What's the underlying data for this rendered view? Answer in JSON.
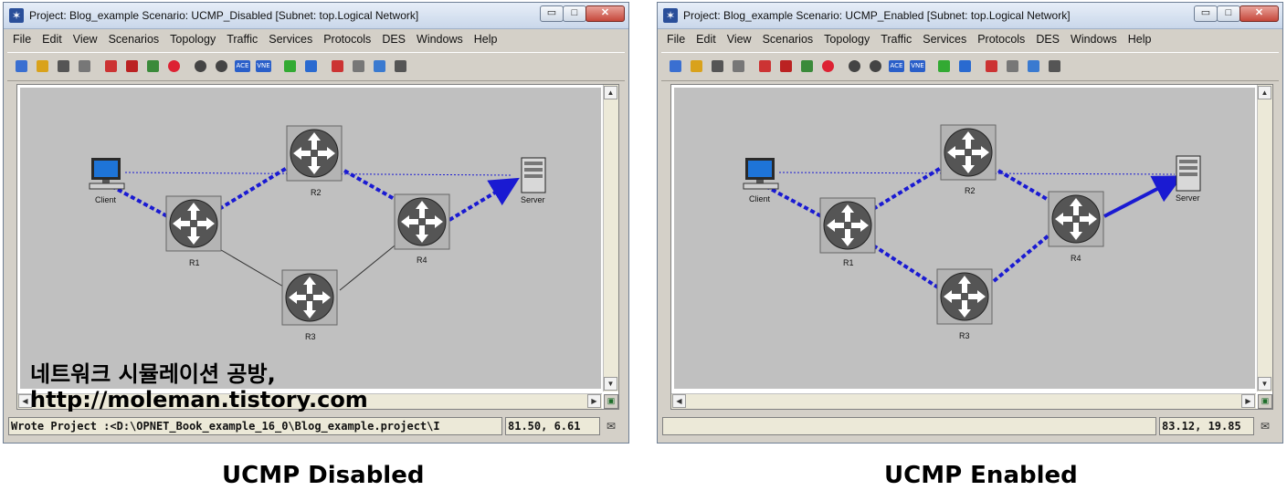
{
  "window_disabled": {
    "title": "Project: Blog_example Scenario: UCMP_Disabled  [Subnet: top.Logical Network]",
    "status_message": "Wrote Project :<D:\\OPNET_Book_example_16_0\\Blog_example.project\\I",
    "coordinates": "81.50, 6.61"
  },
  "window_enabled": {
    "title": "Project: Blog_example Scenario: UCMP_Enabled  [Subnet: top.Logical Network]",
    "status_message": "",
    "coordinates": "83.12, 19.85"
  },
  "menu": [
    "File",
    "Edit",
    "View",
    "Scenarios",
    "Topology",
    "Traffic",
    "Services",
    "Protocols",
    "DES",
    "Windows",
    "Help"
  ],
  "window_buttons": {
    "minimize": "▭",
    "maximize": "□",
    "close": "✕"
  },
  "toolbar_icons": [
    "new-icon",
    "open-icon",
    "save-icon",
    "print-icon",
    "wizard-icon",
    "fail-node-icon",
    "recover-node-icon",
    "location-icon",
    "zoom-in-icon",
    "zoom-out-icon",
    "ace-icon",
    "vne-icon",
    "traffic-light-icon",
    "triangle-icon",
    "run-icon",
    "results-icon",
    "graph-icon",
    "info-icon"
  ],
  "toolbar_labels": {
    "ace": "ACE",
    "vne": "VNE"
  },
  "nodes": {
    "client": "Client",
    "server": "Server",
    "r1": "R1",
    "r2": "R2",
    "r3": "R3",
    "r4": "R4"
  },
  "watermark": {
    "line1": "네트워크 시뮬레이션 공방,",
    "line2": "http://moleman.tistory.com"
  },
  "captions": {
    "left": "UCMP Disabled",
    "right": "UCMP Enabled"
  },
  "colors": {
    "route_blue": "#1a1ad2",
    "canvas_gray": "#c0c0c0",
    "link_black": "#333333"
  }
}
